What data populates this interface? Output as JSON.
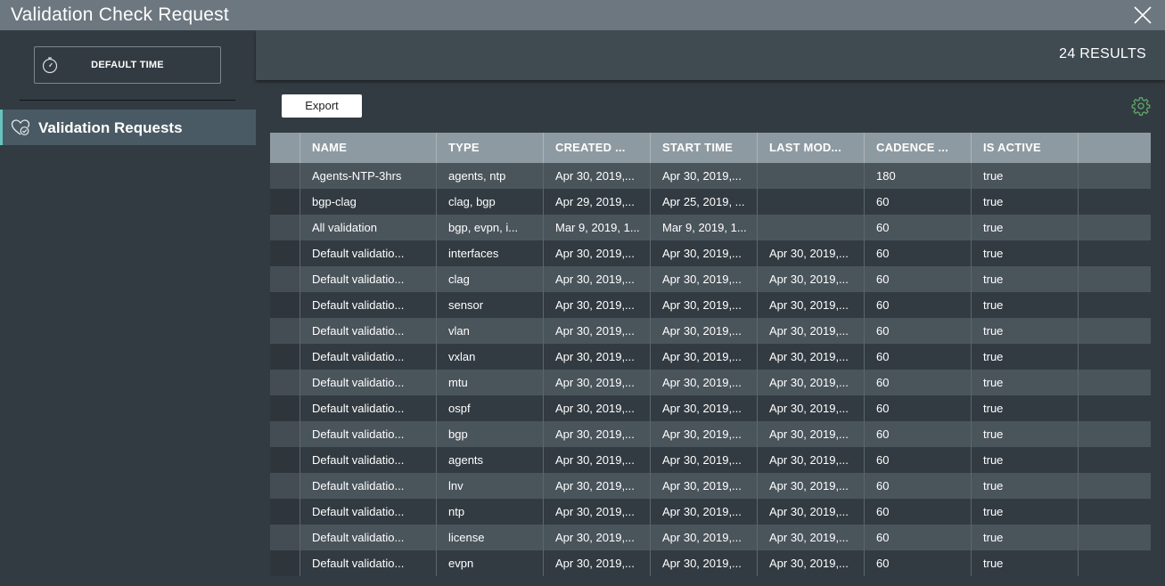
{
  "window": {
    "title": "Validation Check Request"
  },
  "icons": {
    "close": "close-icon",
    "timer": "timer-icon",
    "validation": "heart-check-icon",
    "settings": "gear-icon"
  },
  "colors": {
    "accent": "#66c3bd",
    "titlebar": "#6c7780",
    "header": "#8e9aa2",
    "background": "#323b41"
  },
  "sidebar": {
    "time_button": "DEFAULT TIME",
    "nav_item": "Validation Requests"
  },
  "main": {
    "results": "24 RESULTS",
    "export_label": "Export"
  },
  "table": {
    "columns": [
      "NAME",
      "TYPE",
      "CREATED ...",
      "START TIME",
      "LAST MOD...",
      "CADENCE ...",
      "IS ACTIVE"
    ],
    "rows": [
      [
        "Agents-NTP-3hrs",
        "agents, ntp",
        "Apr 30, 2019,...",
        "Apr 30, 2019,...",
        "",
        "180",
        "true"
      ],
      [
        "bgp-clag",
        "clag, bgp",
        "Apr 29, 2019,...",
        "Apr 25, 2019, ...",
        "",
        "60",
        "true"
      ],
      [
        "All validation",
        "bgp, evpn, i...",
        "Mar 9, 2019, 1...",
        "Mar 9, 2019, 1...",
        "",
        "60",
        "true"
      ],
      [
        "Default validatio...",
        "interfaces",
        "Apr 30, 2019,...",
        "Apr 30, 2019,...",
        "Apr 30, 2019,...",
        "60",
        "true"
      ],
      [
        "Default validatio...",
        "clag",
        "Apr 30, 2019,...",
        "Apr 30, 2019,...",
        "Apr 30, 2019,...",
        "60",
        "true"
      ],
      [
        "Default validatio...",
        "sensor",
        "Apr 30, 2019,...",
        "Apr 30, 2019,...",
        "Apr 30, 2019,...",
        "60",
        "true"
      ],
      [
        "Default validatio...",
        "vlan",
        "Apr 30, 2019,...",
        "Apr 30, 2019,...",
        "Apr 30, 2019,...",
        "60",
        "true"
      ],
      [
        "Default validatio...",
        "vxlan",
        "Apr 30, 2019,...",
        "Apr 30, 2019,...",
        "Apr 30, 2019,...",
        "60",
        "true"
      ],
      [
        "Default validatio...",
        "mtu",
        "Apr 30, 2019,...",
        "Apr 30, 2019,...",
        "Apr 30, 2019,...",
        "60",
        "true"
      ],
      [
        "Default validatio...",
        "ospf",
        "Apr 30, 2019,...",
        "Apr 30, 2019,...",
        "Apr 30, 2019,...",
        "60",
        "true"
      ],
      [
        "Default validatio...",
        "bgp",
        "Apr 30, 2019,...",
        "Apr 30, 2019,...",
        "Apr 30, 2019,...",
        "60",
        "true"
      ],
      [
        "Default validatio...",
        "agents",
        "Apr 30, 2019,...",
        "Apr 30, 2019,...",
        "Apr 30, 2019,...",
        "60",
        "true"
      ],
      [
        "Default validatio...",
        "lnv",
        "Apr 30, 2019,...",
        "Apr 30, 2019,...",
        "Apr 30, 2019,...",
        "60",
        "true"
      ],
      [
        "Default validatio...",
        "ntp",
        "Apr 30, 2019,...",
        "Apr 30, 2019,...",
        "Apr 30, 2019,...",
        "60",
        "true"
      ],
      [
        "Default validatio...",
        "license",
        "Apr 30, 2019,...",
        "Apr 30, 2019,...",
        "Apr 30, 2019,...",
        "60",
        "true"
      ],
      [
        "Default validatio...",
        "evpn",
        "Apr 30, 2019,...",
        "Apr 30, 2019,...",
        "Apr 30, 2019,...",
        "60",
        "true"
      ]
    ]
  }
}
